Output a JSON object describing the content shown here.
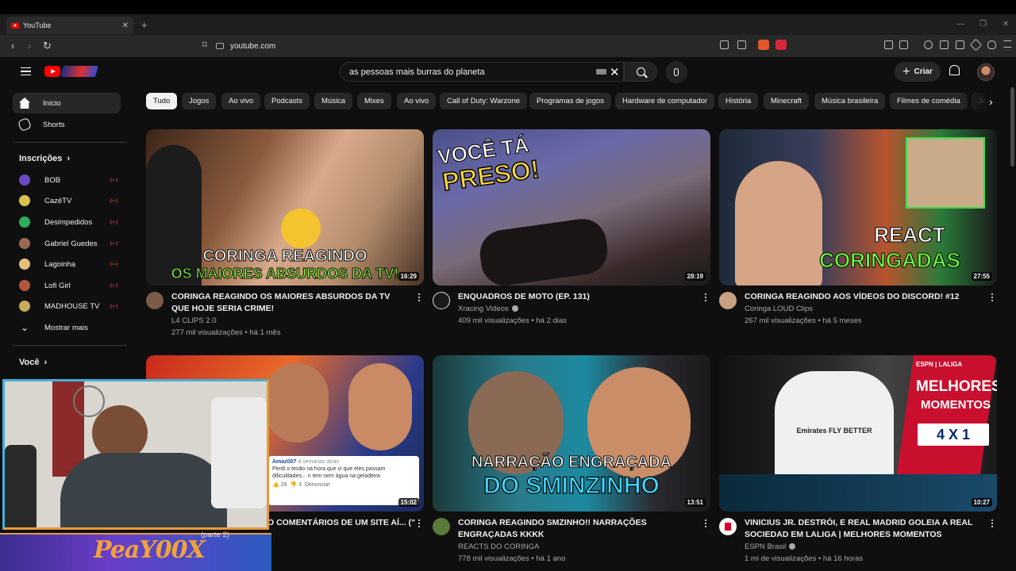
{
  "browser": {
    "tab_title": "YouTube",
    "tab_close": "✕",
    "new_tab": "+",
    "url": "youtube.com",
    "controls": {
      "minimize": "—",
      "restore": "❐",
      "close": "✕"
    }
  },
  "header": {
    "search_query": "as pessoas mais burras do planeta",
    "create_label": "Criar"
  },
  "sidebar": {
    "main": [
      {
        "label": "Início",
        "icon": "home-icon"
      },
      {
        "label": "Shorts",
        "icon": "shorts-icon"
      }
    ],
    "subscriptions_title": "Inscrições",
    "subscriptions": [
      {
        "name": "BOB",
        "color": "#6a4bc2"
      },
      {
        "name": "CazéTV",
        "color": "#d8c24a"
      },
      {
        "name": "Desimpedidos",
        "color": "#2fae5b"
      },
      {
        "name": "Gabriel Guedes",
        "color": "#9a6b52"
      },
      {
        "name": "Lagoinha",
        "color": "#e6c07a"
      },
      {
        "name": "Lofi Girl",
        "color": "#b3563a"
      },
      {
        "name": "MADHOUSE TV",
        "color": "#c9a95b"
      }
    ],
    "show_more": "Mostrar mais",
    "you_title": "Você"
  },
  "chips": [
    "Tudo",
    "Jogos",
    "Ao vivo",
    "Podcasts",
    "Música",
    "Mixes",
    "Ao vivo",
    "Call of Duty: Warzone",
    "Programas de jogos",
    "Hardware de computador",
    "História",
    "Minecraft",
    "Música brasileira",
    "Filmes de comédia",
    "Jo"
  ],
  "videos": [
    {
      "title": "CORINGA REAGINDO OS MAIORES ABSURDOS DA TV QUE HOJE SERIA CRIME!",
      "channel": "L4 CLIPS 2.0",
      "views": "277 mil visualizações",
      "age": "há 1 mês",
      "duration": "16:29",
      "overlay_line1": "CORINGA REAGINDO",
      "overlay_line2": "OS MAIORES ABSURDOS DA TV!",
      "verified": false
    },
    {
      "title": "ENQUADROS DE MOTO (EP. 131)",
      "channel": "Xracing Videos",
      "views": "409 mil visualizações",
      "age": "há 2 dias",
      "duration": "28:19",
      "overlay_line1": "VOCÊ TÁ",
      "overlay_line2": "PRESO!",
      "verified": true
    },
    {
      "title": "CORINGA REAGINDO AOS VÍDEOS DO DISCORD! #12",
      "channel": "Coringa LOUD Clips",
      "views": "267 mil visualizações",
      "age": "há 5 meses",
      "duration": "27:55",
      "overlay_line1": "REACT",
      "overlay_line2": "CORINGADAS",
      "verified": false
    },
    {
      "title": "O COMENTÁRIOS DE UM SITE AÍ... (\"",
      "channel": "",
      "views": "",
      "age": "",
      "duration": "15:02",
      "comment_author": "Amaz007",
      "comment_time": "4 semanas atrás",
      "comment_text": "Perdi o tesão na hora que vi que eles passam dificuldades... n tem nem água na geladeira",
      "comment_likes": "26",
      "comment_dislikes": "3",
      "comment_report": "Denunciar",
      "verified": false
    },
    {
      "title": "CORINGA REAGINDO SMZINHO!! NARRAÇÕES ENGRAÇADAS KKKK",
      "channel": "REACTS DO CORINGA",
      "views": "778 mil visualizações",
      "age": "há 1 ano",
      "duration": "13:51",
      "overlay_line1": "NARRAÇÃO ENGRAÇADA",
      "overlay_line2": "DO SMINZINHO",
      "verified": false
    },
    {
      "title": "VINICIUS JR. DESTRÓI, E REAL MADRID GOLEIA A REAL SOCIEDAD EM LALIGA | MELHORES MOMENTOS",
      "channel": "ESPN Brasil",
      "views": "1 mi de visualizações",
      "age": "há 16 horas",
      "duration": "10:27",
      "overlay_line1": "MELHORES",
      "overlay_line2": "MOMENTOS",
      "score": "4 X 1",
      "league": "ESPN | LALIGA",
      "shirt_text": "Emirates FLY BETTER",
      "verified": true
    }
  ],
  "webcam": {
    "streamer_logo": "PeaY00X",
    "partial_video_label": "(parte 2)"
  }
}
